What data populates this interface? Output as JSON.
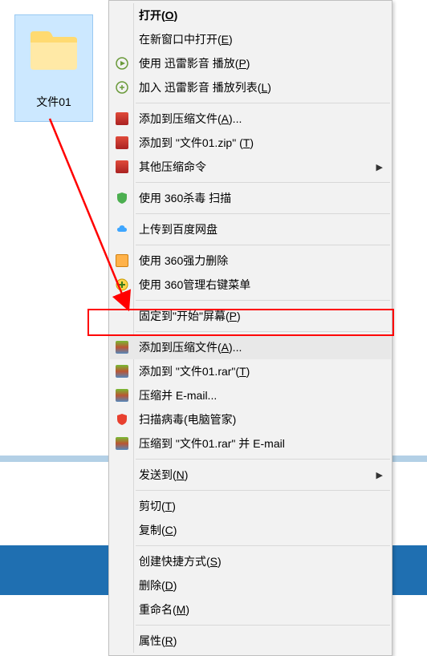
{
  "folder": {
    "label": "文件01"
  },
  "menu": {
    "open": "打开(O)",
    "open_new": "在新窗口中打开(E)",
    "xl_play": "使用 迅雷影音 播放(P)",
    "xl_playlist": "加入 迅雷影音 播放列表(L)",
    "add_archive1": "添加到压缩文件(A)...",
    "add_zip": "添加到 \"文件01.zip\" (T)",
    "other_compress": "其他压缩命令",
    "scan_360": "使用 360杀毒 扫描",
    "baidu_upload": "上传到百度网盘",
    "force_delete": "使用 360强力删除",
    "right_menu_360": "使用 360管理右键菜单",
    "pin_start": "固定到\"开始\"屏幕(P)",
    "add_archive2": "添加到压缩文件(A)...",
    "add_rar": "添加到 \"文件01.rar\"(T)",
    "zip_email": "压缩并 E-mail...",
    "scan_virus": "扫描病毒(电脑管家)",
    "zip_rar_email": "压缩到 \"文件01.rar\" 并 E-mail",
    "send_to": "发送到(N)",
    "cut": "剪切(T)",
    "copy": "复制(C)",
    "shortcut": "创建快捷方式(S)",
    "delete": "删除(D)",
    "rename": "重命名(M)",
    "properties": "属性(R)"
  }
}
